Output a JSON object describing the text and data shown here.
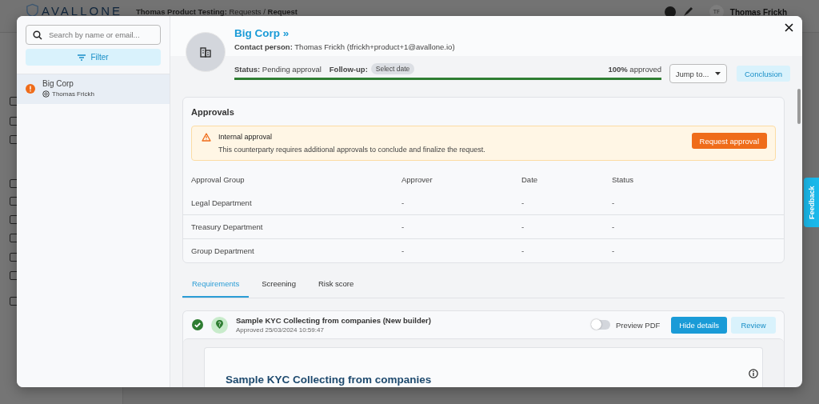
{
  "background": {
    "logo": "AVALLONE",
    "breadcrumb": "**Thomas Product Testing:** Requests / **Request**",
    "user_name": "Thomas Frickh",
    "user_initials": "TF"
  },
  "sidebar": {
    "search": {
      "placeholder": "Search by name or email..."
    },
    "filter_button": "Filter",
    "items": [
      {
        "name": "Big Corp",
        "contact": "Thomas Frickh",
        "selected": true,
        "alert": true
      }
    ]
  },
  "header": {
    "title": "Big Corp »",
    "contact_label": "Contact person:",
    "contact_value": "Thomas Frickh (tfrickh+product+1@avallone.io)",
    "status_label": "Status:",
    "status_value": "Pending approval",
    "followup_label": "Follow-up:",
    "followup_value": "Select date",
    "progress": {
      "level": 1.0,
      "percent": "100%",
      "suffix": "approved"
    },
    "jump_button": "Jump to...",
    "conclusion_button": "Conclusion"
  },
  "approvals": {
    "title": "Approvals",
    "alert": {
      "title": "Internal approval",
      "text": "This counterparty requires additional approvals to conclude and finalize the request.",
      "button": "Request approval"
    },
    "columns": [
      "Approval Group",
      "Approver",
      "Date",
      "Status"
    ],
    "rows": [
      [
        "Legal Department",
        "-",
        "-",
        "-"
      ],
      [
        "Treasury Department",
        "-",
        "-",
        "-"
      ],
      [
        "Group Department",
        "-",
        "-",
        "-"
      ]
    ]
  },
  "tabs": [
    {
      "label": "Requirements",
      "selected": true
    },
    {
      "label": "Screening",
      "selected": false
    },
    {
      "label": "Risk score",
      "selected": false
    }
  ],
  "requirement": {
    "title": "Sample KYC Collecting from companies (New builder)",
    "subtitle": "Approved 25/03/2024 10:59:47",
    "approved": true,
    "preview_pdf": {
      "label": "Preview PDF",
      "on": false
    },
    "hide_button": "Hide details",
    "review_button": "Review",
    "document_title": "Sample KYC Collecting from companies"
  },
  "feedback": "Feedback"
}
